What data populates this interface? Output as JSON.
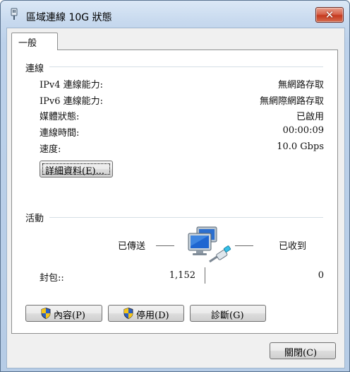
{
  "window": {
    "title": "區域連線 10G 狀態"
  },
  "tab": {
    "label": "一般"
  },
  "connection": {
    "header": "連線",
    "rows": [
      {
        "label": "IPv4 連線能力:",
        "value": "無網路存取"
      },
      {
        "label": "IPv6 連線能力:",
        "value": "無網際網路存取"
      },
      {
        "label": "媒體狀態:",
        "value": "已啟用"
      },
      {
        "label": "連線時間:",
        "value": "00:00:09"
      },
      {
        "label": "速度:",
        "value": "10.0 Gbps"
      }
    ],
    "details_button": "詳細資料(E)..."
  },
  "activity": {
    "header": "活動",
    "sent_label": "已傳送",
    "received_label": "已收到",
    "packets_label": "封包::",
    "packets_sent": "1,152",
    "packets_received": "0"
  },
  "buttons": {
    "properties": "內容(P)",
    "disable": "停用(D)",
    "diagnose": "診斷(G)",
    "close": "關閉(C)"
  },
  "icons": {
    "titlebar": "network-icon",
    "activity": "network-activity-icon",
    "shield": "uac-shield-icon"
  }
}
